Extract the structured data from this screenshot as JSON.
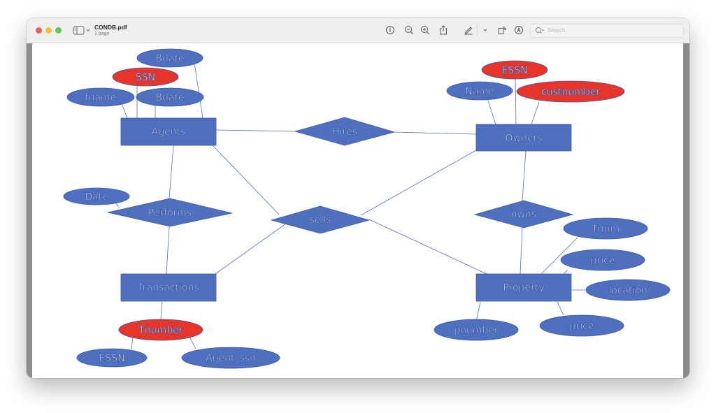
{
  "window": {
    "title": "CONDB.pdf",
    "subtitle": "1 page"
  },
  "toolbar": {
    "icons": [
      "info-icon",
      "zoom-out-icon",
      "zoom-in-icon",
      "share-icon",
      "markup-pen-icon",
      "chevron-down-icon",
      "rotate-icon",
      "annotate-icon"
    ],
    "search_placeholder": "Search"
  },
  "colors": {
    "entity_fill": "#4f6fbf",
    "key_attribute_fill": "#e8352a",
    "line": "#4f6fbf"
  },
  "diagram": {
    "entities": {
      "agents": "Agents",
      "owners": "Owners",
      "transactions": "Transactions",
      "property": "Property"
    },
    "relationships": {
      "hires": "Hires",
      "performs": "Performs",
      "sells": "sells",
      "owns": "owns"
    },
    "attributes": {
      "agents_bdate_top": "Bdate",
      "agents_ssn": "SSN",
      "agents_fname": "fname",
      "agents_bdate": "Bdate",
      "owners_essn": "ESSN",
      "owners_name": "Name",
      "owners_custnumber": "custnumber",
      "performs_date": "Date",
      "transactions_tnumber": "Tnumber",
      "transactions_essn": "ESSN",
      "transactions_agent_ssn": "Agent_ssn",
      "property_tnum": "Tnum",
      "property_price_top": "price",
      "property_location": "location",
      "property_price_bottom": "price",
      "property_pnumber": "pnumber"
    },
    "key_attributes": [
      "agents_ssn",
      "owners_essn",
      "owners_custnumber",
      "transactions_tnumber"
    ]
  }
}
